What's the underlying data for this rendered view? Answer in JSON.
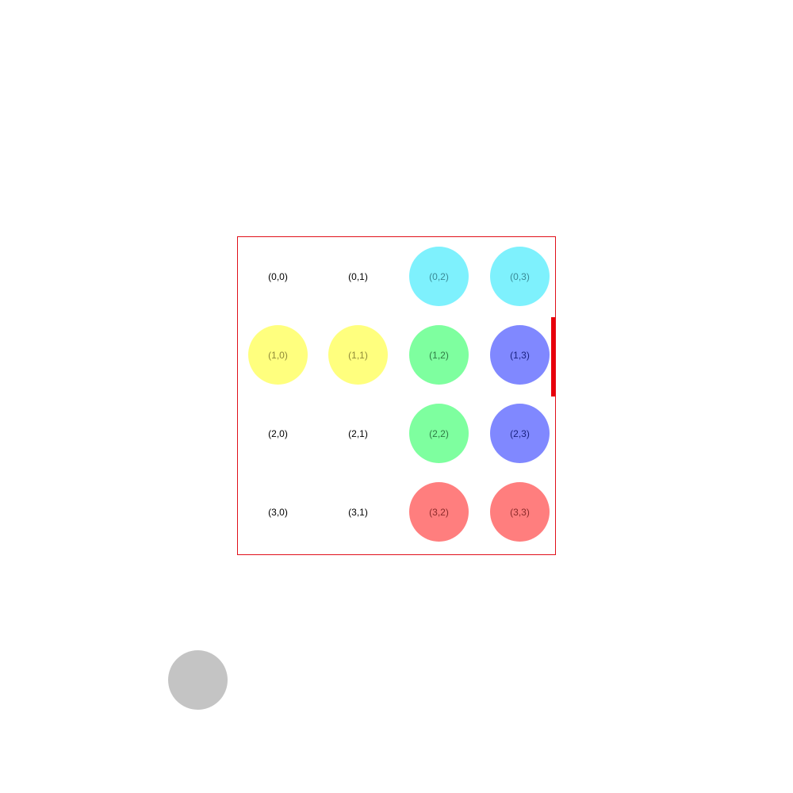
{
  "board": {
    "border_color": "#e0101a",
    "cells": [
      {
        "row": 0,
        "col": 0,
        "label": "(0,0)",
        "fill": null,
        "text_color": "#000000"
      },
      {
        "row": 0,
        "col": 1,
        "label": "(0,1)",
        "fill": null,
        "text_color": "#000000"
      },
      {
        "row": 0,
        "col": 2,
        "label": "(0,2)",
        "fill": "#7ef1fd",
        "text_color": "#3a8a96"
      },
      {
        "row": 0,
        "col": 3,
        "label": "(0,3)",
        "fill": "#7ef1fd",
        "text_color": "#3a8a96"
      },
      {
        "row": 1,
        "col": 0,
        "label": "(1,0)",
        "fill": "#ffff7e",
        "text_color": "#8f8a3a"
      },
      {
        "row": 1,
        "col": 1,
        "label": "(1,1)",
        "fill": "#ffff7e",
        "text_color": "#8f8a3a"
      },
      {
        "row": 1,
        "col": 2,
        "label": "(1,2)",
        "fill": "#7eff9f",
        "text_color": "#2f7a45"
      },
      {
        "row": 1,
        "col": 3,
        "label": "(1,3)",
        "fill": "#8088ff",
        "text_color": "#1a2380"
      },
      {
        "row": 2,
        "col": 0,
        "label": "(2,0)",
        "fill": null,
        "text_color": "#000000"
      },
      {
        "row": 2,
        "col": 1,
        "label": "(2,1)",
        "fill": null,
        "text_color": "#000000"
      },
      {
        "row": 2,
        "col": 2,
        "label": "(2,2)",
        "fill": "#7eff9f",
        "text_color": "#2f7a45"
      },
      {
        "row": 2,
        "col": 3,
        "label": "(2,3)",
        "fill": "#8088ff",
        "text_color": "#1a2380"
      },
      {
        "row": 3,
        "col": 0,
        "label": "(3,0)",
        "fill": null,
        "text_color": "#000000"
      },
      {
        "row": 3,
        "col": 1,
        "label": "(3,1)",
        "fill": null,
        "text_color": "#000000"
      },
      {
        "row": 3,
        "col": 2,
        "label": "(3,2)",
        "fill": "#ff7e7e",
        "text_color": "#8a2a2a"
      },
      {
        "row": 3,
        "col": 3,
        "label": "(3,3)",
        "fill": "#ff7e7e",
        "text_color": "#8a2a2a"
      }
    ]
  },
  "side_marker": {
    "color": "#e8000b"
  },
  "reserve_piece": {
    "color": "#c4c4c4"
  }
}
